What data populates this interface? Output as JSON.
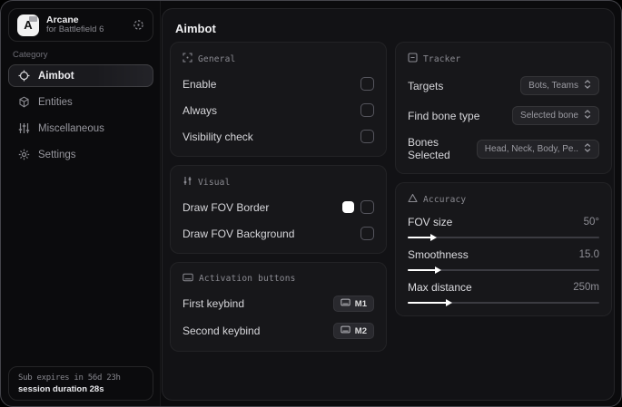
{
  "app": {
    "logo_letter": "A",
    "name": "Arcane",
    "subtitle": "for Battlefield 6"
  },
  "sidebar": {
    "category_label": "Category",
    "items": [
      {
        "label": "Aimbot",
        "active": true
      },
      {
        "label": "Entities",
        "active": false
      },
      {
        "label": "Miscellaneous",
        "active": false
      },
      {
        "label": "Settings",
        "active": false
      }
    ],
    "footer": {
      "line1": "Sub expires in 56d 23h",
      "line2": "session duration 28s"
    }
  },
  "main": {
    "title": "Aimbot",
    "general": {
      "title": "General",
      "rows": [
        {
          "label": "Enable",
          "checked": false
        },
        {
          "label": "Always",
          "checked": false
        },
        {
          "label": "Visibility check",
          "checked": false
        }
      ]
    },
    "visual": {
      "title": "Visual",
      "rows": [
        {
          "label": "Draw FOV Border",
          "swatch": "#ffffff",
          "checked": false
        },
        {
          "label": "Draw FOV Background",
          "checked": false
        }
      ]
    },
    "activation": {
      "title": "Activation buttons",
      "rows": [
        {
          "label": "First keybind",
          "key": "M1"
        },
        {
          "label": "Second keybind",
          "key": "M2"
        }
      ]
    },
    "tracker": {
      "title": "Tracker",
      "rows": [
        {
          "label": "Targets",
          "value": "Bots, Teams"
        },
        {
          "label": "Find bone type",
          "value": "Selected bone"
        },
        {
          "label": "Bones Selected",
          "value": "Head, Neck, Body, Pe.."
        }
      ]
    },
    "accuracy": {
      "title": "Accuracy",
      "rows": [
        {
          "label": "FOV size",
          "value": "50°",
          "fill_pct": 13
        },
        {
          "label": "Smoothness",
          "value": "15.0",
          "fill_pct": 15
        },
        {
          "label": "Max distance",
          "value": "250m",
          "fill_pct": 21
        }
      ]
    }
  }
}
